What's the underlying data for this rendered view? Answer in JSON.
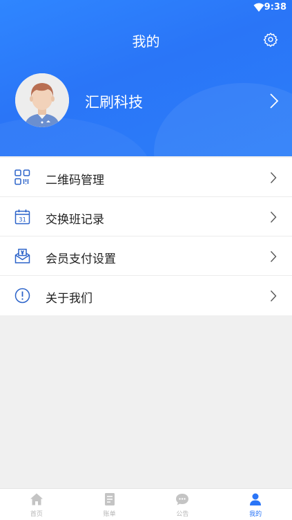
{
  "status_bar": {
    "time": "9:38"
  },
  "header": {
    "title": "我的"
  },
  "profile": {
    "name": "汇刷科技"
  },
  "menu": [
    {
      "label": "二维码管理",
      "icon": "qr-code-icon"
    },
    {
      "label": "交换班记录",
      "icon": "calendar-icon"
    },
    {
      "label": "会员支付设置",
      "icon": "envelope-payment-icon"
    },
    {
      "label": "关于我们",
      "icon": "info-icon"
    }
  ],
  "tabs": [
    {
      "label": "首页",
      "icon": "home-icon"
    },
    {
      "label": "账单",
      "icon": "bill-icon"
    },
    {
      "label": "公告",
      "icon": "chat-icon"
    },
    {
      "label": "我的",
      "icon": "person-icon",
      "active": true
    }
  ],
  "colors": {
    "primary": "#2a75f7",
    "icon_blue": "#2a62c9",
    "inactive": "#b6b6b6"
  }
}
